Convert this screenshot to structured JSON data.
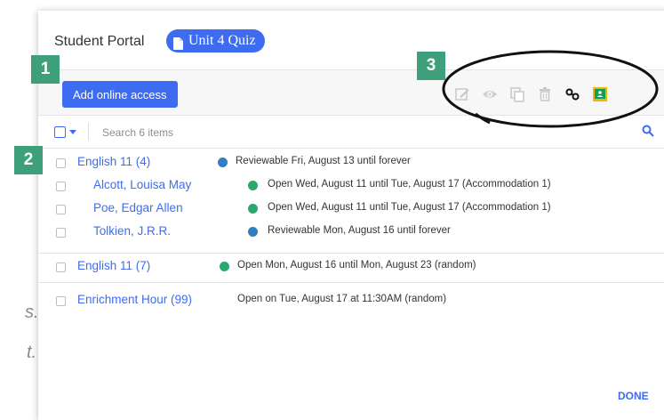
{
  "background_text": [
    "s.",
    "t."
  ],
  "dialog": {
    "portal_title": "Student Portal",
    "quiz_label": "Unit 4 Quiz",
    "add_button": "Add online access",
    "search_placeholder": "Search 6 items",
    "groups": [
      {
        "name": "English 11 (4)",
        "status": "Reviewable Fri, August 13 until forever",
        "dot_color": "#2f7fc4",
        "students": [
          {
            "name": "Alcott, Louisa May",
            "status": "Open Wed, August 11 until Tue, August 17 (Accommodation 1)",
            "dot_color": "#29a96b"
          },
          {
            "name": "Poe, Edgar Allen",
            "status": "Open Wed, August 11 until Tue, August 17 (Accommodation 1)",
            "dot_color": "#29a96b"
          },
          {
            "name": "Tolkien, J.R.R.",
            "status": "Reviewable Mon, August 16 until forever",
            "dot_color": "#2f7fc4"
          }
        ]
      },
      {
        "name": "English 11 (7)",
        "status": "Open Mon, August 16 until Mon, August 23 (random)",
        "dot_color": "#29a96b"
      },
      {
        "name": "Enrichment Hour (99)",
        "status": "Open on Tue, August 17 at 11:30AM (random)",
        "dot_color": null
      }
    ],
    "done_label": "DONE"
  },
  "toolbar_icons": [
    "edit-icon",
    "eye-icon",
    "copy-icon",
    "trash-icon",
    "link-icon",
    "google-classroom-icon"
  ],
  "callouts": [
    "1",
    "2",
    "3"
  ],
  "colors": {
    "accent": "#3d6cf0",
    "open": "#29a96b",
    "reviewable": "#2f7fc4",
    "callout": "#3ea07b"
  }
}
